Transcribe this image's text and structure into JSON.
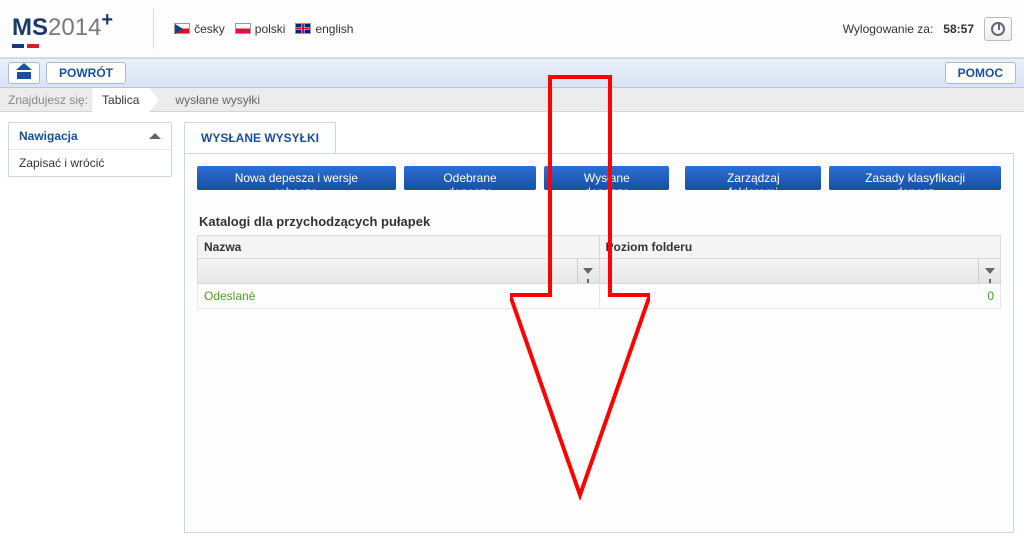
{
  "header": {
    "logo_ms": "MS",
    "logo_year": "2014",
    "logo_plus": "+",
    "langs": [
      {
        "code": "cz",
        "label": "česky"
      },
      {
        "code": "pl",
        "label": "polski"
      },
      {
        "code": "en",
        "label": "english"
      }
    ],
    "logout_label": "Wylogowanie za:",
    "logout_time": "58:57"
  },
  "toolbar": {
    "home_label": "",
    "back_label": "POWRÓT",
    "help_label": "POMOC"
  },
  "breadcrumb": {
    "prefix": "Znajdujesz się:",
    "items": [
      "Tablica",
      "wysłane wysyłki"
    ]
  },
  "sidebar": {
    "nav_title": "Nawigacja",
    "items": [
      "Zapisać i wrócić"
    ]
  },
  "main": {
    "tab_label": "WYSŁANE WYSYŁKI",
    "buttons": {
      "new": "Nowa depesza i wersje robocze",
      "received": "Odebrane depesze",
      "sent": "Wysłane depesze",
      "manage": "Zarządzaj folderami",
      "rules": "Zasady klasyfikacji depesz"
    },
    "section_title": "Katalogi dla przychodzących pułapek",
    "columns": {
      "name": "Nazwa",
      "level": "Poziom folderu"
    },
    "rows": [
      {
        "name": "Odeslané",
        "level": "0"
      }
    ]
  }
}
